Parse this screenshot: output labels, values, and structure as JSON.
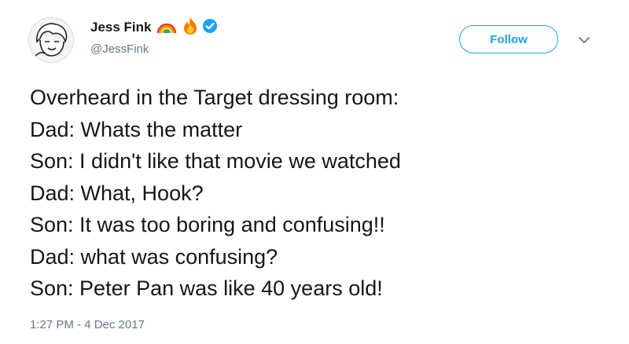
{
  "author": {
    "display_name": "Jess Fink",
    "handle": "@JessFink",
    "name_emoji": [
      "rainbow-icon",
      "fire-icon"
    ],
    "verified": true
  },
  "actions": {
    "follow_label": "Follow"
  },
  "tweet": {
    "lines": [
      "Overheard in the Target dressing room:",
      "Dad: Whats the matter",
      "Son: I didn't like that movie we watched",
      "Dad: What, Hook?",
      "Son: It was too boring and confusing!!",
      "Dad: what was confusing?",
      "Son: Peter Pan was like 40 years old!"
    ],
    "timestamp": "1:27 PM - 4 Dec 2017"
  },
  "colors": {
    "accent": "#1da1f2",
    "text": "#14171a",
    "muted": "#657786"
  }
}
